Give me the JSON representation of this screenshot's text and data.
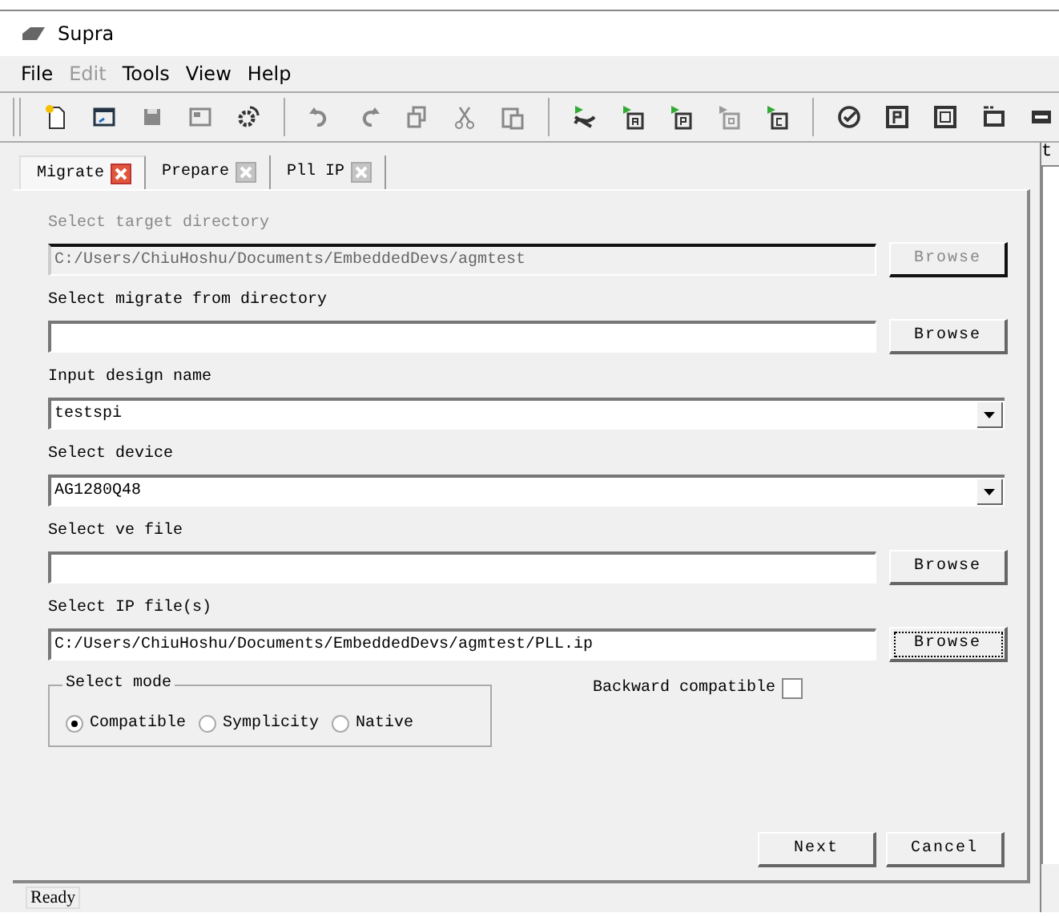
{
  "window": {
    "title": "Supra"
  },
  "menu": [
    {
      "label": "File",
      "disabled": false
    },
    {
      "label": "Edit",
      "disabled": true
    },
    {
      "label": "Tools",
      "disabled": false
    },
    {
      "label": "View",
      "disabled": false
    },
    {
      "label": "Help",
      "disabled": false
    }
  ],
  "tabs": [
    {
      "label": "Migrate",
      "selected": true
    },
    {
      "label": "Prepare",
      "selected": false
    },
    {
      "label": "Pll IP",
      "selected": false
    }
  ],
  "fields": [
    {
      "kind": "path",
      "label": "Select target directory",
      "value": "C:/Users/ChiuHoshu/Documents/EmbeddedDevs/agmtest",
      "disabled": true,
      "button": {
        "label": "Browse",
        "focused": false
      }
    },
    {
      "kind": "path",
      "label": "Select migrate from directory",
      "disabled": false,
      "button": {
        "label": "Browse",
        "focused": false
      }
    },
    {
      "kind": "combo",
      "label": "Input design name",
      "value": "testspi",
      "disabled": false
    },
    {
      "kind": "combo",
      "label": "Select device",
      "value": "AG1280Q48",
      "disabled": false
    },
    {
      "kind": "path",
      "label": "Select ve file",
      "disabled": false,
      "button": {
        "label": "Browse",
        "focused": false
      }
    },
    {
      "kind": "path",
      "label": "Select IP file(s)",
      "value": "C:/Users/ChiuHoshu/Documents/EmbeddedDevs/agmtest/PLL.ip",
      "disabled": false,
      "button": {
        "label": "Browse",
        "focused": true
      }
    }
  ],
  "mode": {
    "title": "Select mode",
    "options": [
      {
        "label": "Compatible",
        "selected": true
      },
      {
        "label": "Symplicity",
        "selected": false
      },
      {
        "label": "Native",
        "selected": false
      }
    ]
  },
  "backward": {
    "label": "Backward compatible",
    "checked": false
  },
  "buttons": [
    "Next",
    "Cancel"
  ],
  "side_panel": {
    "text": "t"
  },
  "status_bar": "Ready"
}
